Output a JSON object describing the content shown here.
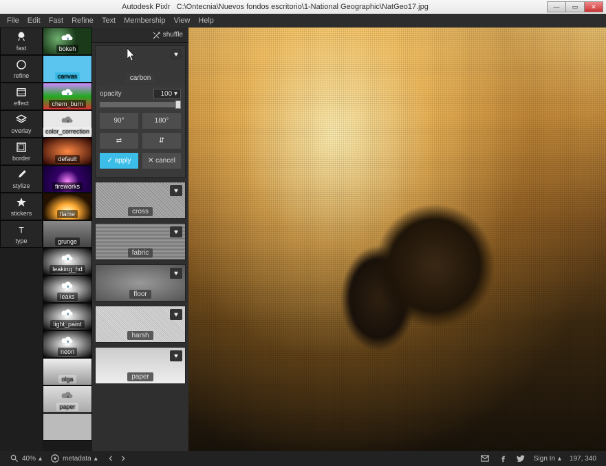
{
  "titlebar": {
    "app": "Autodesk Pixlr",
    "path": "C:\\Ontecnia\\Nuevos fondos escritorio\\1-National Geographic\\NatGeo17.jpg"
  },
  "menu": [
    "File",
    "Edit",
    "Fast",
    "Refine",
    "Text",
    "Membership",
    "View",
    "Help"
  ],
  "tools": [
    {
      "id": "fast",
      "label": "fast",
      "icon": "rocket"
    },
    {
      "id": "refine",
      "label": "refine",
      "icon": "circle"
    },
    {
      "id": "effect",
      "label": "effect",
      "icon": "film"
    },
    {
      "id": "overlay",
      "label": "overlay",
      "icon": "layers"
    },
    {
      "id": "border",
      "label": "border",
      "icon": "frame"
    },
    {
      "id": "stylize",
      "label": "stylize",
      "icon": "brush"
    },
    {
      "id": "stickers",
      "label": "stickers",
      "icon": "star"
    },
    {
      "id": "type",
      "label": "type",
      "icon": "text"
    }
  ],
  "presets": [
    {
      "id": "bokeh",
      "label": "bokeh",
      "bg": "bg-bokeh",
      "cloud": true
    },
    {
      "id": "canvas",
      "label": "canvas",
      "bg": "bg-canvas",
      "sel": true
    },
    {
      "id": "chem_burn",
      "label": "chem_burn",
      "bg": "bg-chemburn",
      "cloud": true
    },
    {
      "id": "color_correction",
      "label": "color_correction",
      "bg": "bg-colorcorr",
      "cloud": true,
      "dark": true
    },
    {
      "id": "default",
      "label": "default",
      "bg": "bg-default"
    },
    {
      "id": "fireworks",
      "label": "fireworks",
      "bg": "bg-fireworks"
    },
    {
      "id": "flame",
      "label": "flame",
      "bg": "bg-flame"
    },
    {
      "id": "grunge",
      "label": "grunge",
      "bg": "bg-grunge"
    },
    {
      "id": "leaking_hd",
      "label": "leaking_hd",
      "bg": "bg-leakinghd",
      "cloud": true
    },
    {
      "id": "leaks",
      "label": "leaks",
      "bg": "bg-leaks",
      "cloud": true
    },
    {
      "id": "light_paint",
      "label": "light_paint",
      "bg": "bg-lightpaint",
      "cloud": true
    },
    {
      "id": "neon",
      "label": "neon",
      "bg": "bg-neon",
      "cloud": true
    },
    {
      "id": "olga",
      "label": "olga",
      "bg": "bg-olga",
      "dark": true
    },
    {
      "id": "paper",
      "label": "paper",
      "bg": "bg-paper",
      "cloud": true,
      "dark": true
    },
    {
      "id": "paper2",
      "label": "",
      "bg": "bg-paper2"
    }
  ],
  "panel": {
    "shuffle": "shuffle",
    "active": {
      "label": "carbon",
      "opacity_label": "opacity",
      "opacity_value": "100",
      "rot90": "90°",
      "rot180": "180°",
      "apply": "apply",
      "cancel": "cancel"
    },
    "overlays": [
      {
        "id": "cross",
        "label": "cross"
      },
      {
        "id": "fabric",
        "label": "fabric"
      },
      {
        "id": "floor",
        "label": "floor"
      },
      {
        "id": "harsh",
        "label": "harsh"
      },
      {
        "id": "paper",
        "label": "paper"
      }
    ]
  },
  "status": {
    "zoom": "40%",
    "metadata": "metadata",
    "signin": "Sign In",
    "coords": "197, 340"
  }
}
